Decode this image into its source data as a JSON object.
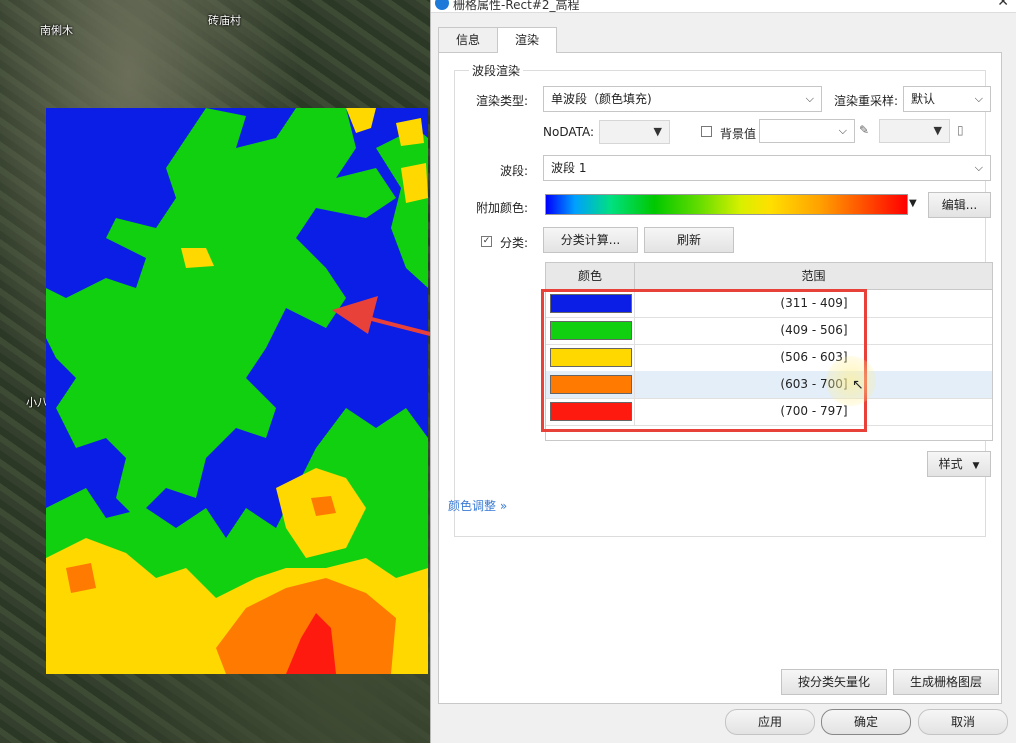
{
  "map": {
    "labels": [
      "南俐木",
      "砖庙村",
      "小八"
    ]
  },
  "window": {
    "title": "栅格属性-Rect#2_高程",
    "close": "✕"
  },
  "tabs": [
    "信息",
    "渲染"
  ],
  "band_render": {
    "group_title": "波段渲染",
    "render_type_label": "渲染类型:",
    "render_type_value": "单波段（颜色填充)",
    "resample_label": "渲染重采样:",
    "resample_value": "默认",
    "nodata_label": "NoDATA:",
    "background_label": "背景值",
    "band_label": "波段:",
    "band_value": "波段 1",
    "extra_color_label": "附加颜色:",
    "edit_button": "编辑...",
    "classify_label": "分类:",
    "classify_calc_button": "分类计算...",
    "refresh_button": "刷新"
  },
  "class_table": {
    "headers": [
      "颜色",
      "范围"
    ],
    "rows": [
      {
        "color": "#0a1ee6",
        "range": "(311 - 409]"
      },
      {
        "color": "#10d010",
        "range": "(409 - 506]"
      },
      {
        "color": "#ffd800",
        "range": "(506 - 603]"
      },
      {
        "color": "#ff7a00",
        "range": "(603 - 700]"
      },
      {
        "color": "#ff1a10",
        "range": "(700 - 797]"
      }
    ]
  },
  "style_button": "样式",
  "color_adjust_link": "颜色调整",
  "bottom_buttons": {
    "vectorize": "按分类矢量化",
    "gen_raster": "生成栅格图层",
    "apply": "应用",
    "ok": "确定",
    "cancel": "取消"
  },
  "colors": {
    "class_blue": "#0a1ee6",
    "class_green": "#10d010",
    "class_yellow": "#ffd800",
    "class_orange": "#ff7a00",
    "class_red": "#ff1a10",
    "highlight_box": "#e8413a"
  }
}
